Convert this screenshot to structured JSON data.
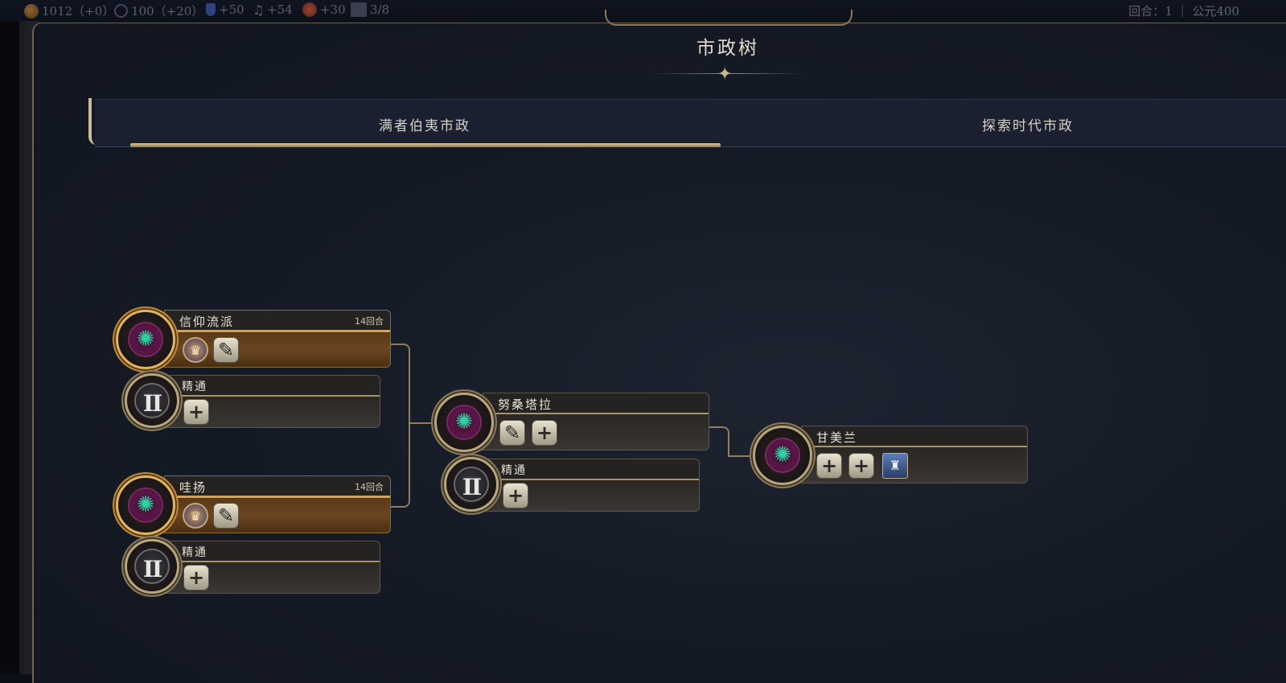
{
  "resources": [
    {
      "icon": "gold-icon",
      "text": "1012（+0）"
    },
    {
      "icon": "influence-icon",
      "text": "100（+20）"
    },
    {
      "icon": "science-icon",
      "text": "+50"
    },
    {
      "icon": "culture-icon",
      "text": "+54"
    },
    {
      "icon": "happiness-icon",
      "text": "+30"
    },
    {
      "icon": "settlement-icon",
      "text": "3/8"
    }
  ],
  "turn_info": "回合：1 ｜ 公元400",
  "screen_title": "市政树",
  "tabs": [
    {
      "label": "满者伯夷市政",
      "selected": true
    },
    {
      "label": "探索时代市政",
      "selected": false
    }
  ],
  "civics": {
    "xinyang": {
      "name": "信仰流派",
      "turns": "14回合"
    },
    "xinyang_mastery": {
      "name": "精通"
    },
    "wayang": {
      "name": "哇扬",
      "turns": "14回合"
    },
    "wayang_mastery": {
      "name": "精通"
    },
    "nusantara": {
      "name": "努桑塔拉"
    },
    "nusantara_mastery": {
      "name": "精通"
    },
    "gamelan": {
      "name": "甘美兰"
    }
  },
  "mastery_numeral": "II",
  "glyphs": {
    "plus": "+",
    "star": "✺",
    "quill": "✎",
    "unit": "♛",
    "wonder": "♜"
  },
  "colors": {
    "accent_gold": "#c9a465",
    "active_bar": "#6b4520",
    "teal_star": "#2fd1a3"
  }
}
